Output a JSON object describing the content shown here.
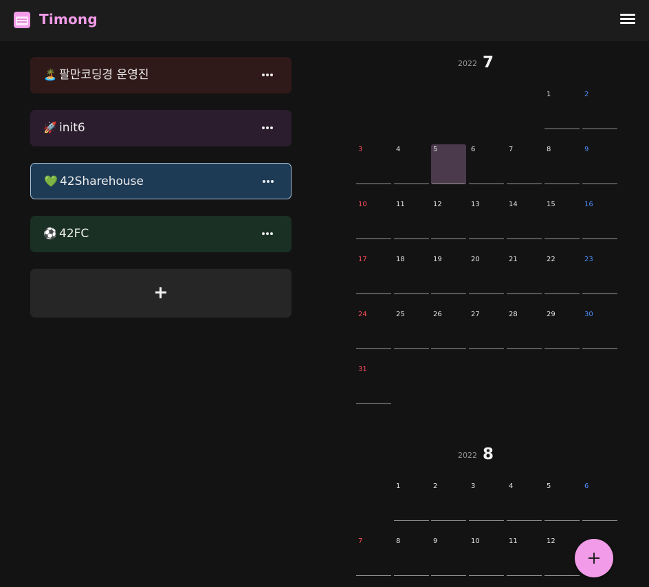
{
  "header": {
    "title": "Timong",
    "logo_icon": "calendar-icon",
    "menu_icon": "hamburger-menu-icon",
    "brand_color": "#f29be8"
  },
  "groups": [
    {
      "emoji": "🏝️",
      "name": "팔만코딩경 운영진",
      "bg": "#301a19",
      "border": "none",
      "more_icon": "more-dots-icon"
    },
    {
      "emoji": "🚀",
      "name": "init6",
      "bg": "#2b1d2e",
      "border": "none",
      "more_icon": "more-dots-icon"
    },
    {
      "emoji": "💚",
      "name": "42Sharehouse",
      "bg": "#1e3b56",
      "border": "#a9c6e0",
      "more_icon": "more-dots-icon"
    },
    {
      "emoji": "⚽",
      "name": "42FC",
      "bg": "#1b3025",
      "border": "none",
      "more_icon": "more-dots-icon"
    }
  ],
  "add_group": {
    "icon": "plus-icon"
  },
  "calendar": {
    "months": [
      {
        "year": "2022",
        "month": "7",
        "first_weekday": 5,
        "days": 31,
        "today": 5
      },
      {
        "year": "2022",
        "month": "8",
        "first_weekday": 1,
        "days": 12,
        "today": null
      }
    ],
    "colors": {
      "sunday": "#ff4d5e",
      "saturday": "#4f8dff",
      "today": "#4b3a4b"
    }
  },
  "fab": {
    "icon": "plus-icon",
    "color": "#f29be8"
  }
}
